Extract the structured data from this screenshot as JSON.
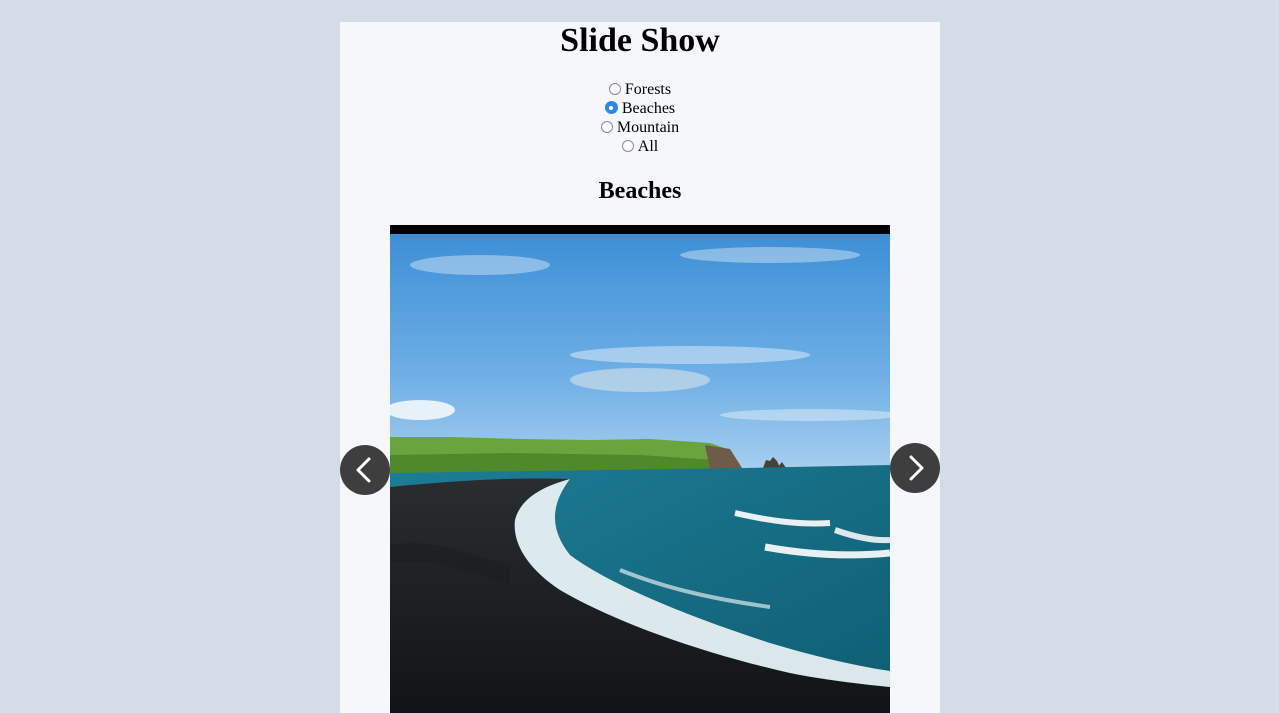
{
  "page": {
    "title": "Slide Show"
  },
  "categories": {
    "options": [
      {
        "label": "Forests",
        "checked": false
      },
      {
        "label": "Beaches",
        "checked": true
      },
      {
        "label": "Mountain",
        "checked": false
      },
      {
        "label": "All",
        "checked": false
      }
    ]
  },
  "slide": {
    "heading": "Beaches",
    "image_description_icon": "beach-photo"
  },
  "controls": {
    "prev_icon": "chevron-left-icon",
    "next_icon": "chevron-right-icon"
  },
  "colors": {
    "background": "#d3dce7",
    "panel": "#f5f7fb",
    "radio_checked": "#2f88e8",
    "nav_button": "#3e3e3e"
  }
}
